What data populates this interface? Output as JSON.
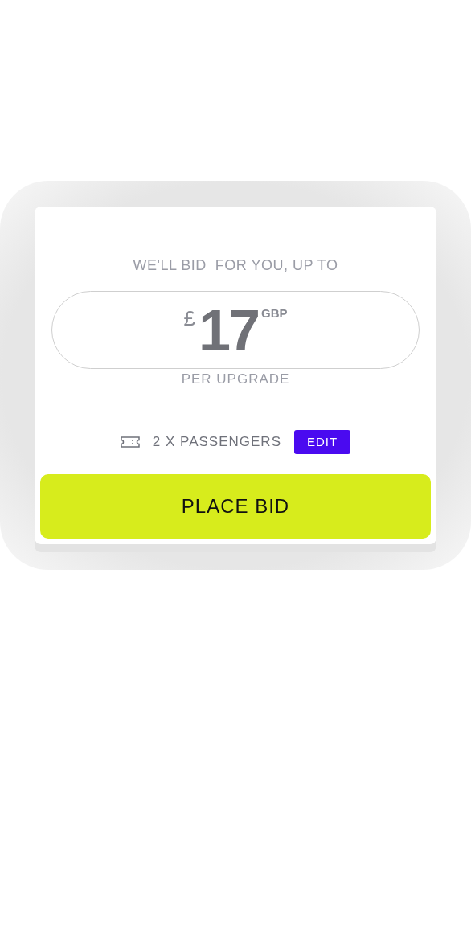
{
  "bid_card": {
    "heading": "WE'LL BID  FOR YOU, UP TO",
    "amount": {
      "currency_symbol": "£",
      "value": "17",
      "currency_code": "GBP"
    },
    "unit": "PER UPGRADE",
    "passengers": {
      "label": "2 X PASSENGERS",
      "edit_button": "EDIT"
    },
    "place_bid_button": "PLACE BID"
  }
}
